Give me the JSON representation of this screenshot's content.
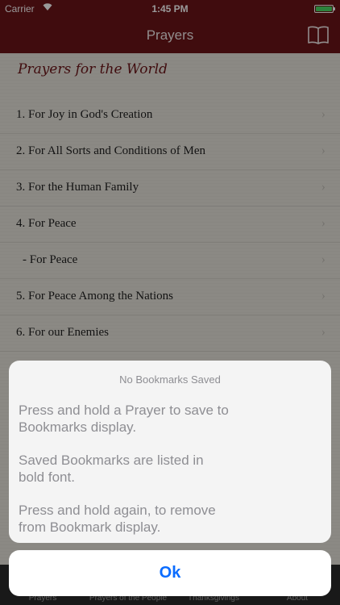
{
  "status": {
    "carrier": "Carrier",
    "time": "1:45 PM"
  },
  "navbar": {
    "title": "Prayers"
  },
  "section": {
    "title": "Prayers for the World"
  },
  "list": [
    "1. For Joy in God's Creation",
    "2. For All Sorts and Conditions of Men",
    "3. For the Human Family",
    "4. For Peace",
    "- For Peace",
    "5. For Peace Among the Nations",
    "6. For our Enemies"
  ],
  "tabs": [
    "Prayers",
    "Prayers of the People",
    "Thanksgivings",
    "About"
  ],
  "alert": {
    "title": "No Bookmarks Saved",
    "message_1_line_1": "Press and hold a Prayer to save to",
    "message_1_line_2": "Bookmarks display.",
    "message_2_line_1": "Saved Bookmarks are listed in",
    "message_2_line_2": "bold font.",
    "message_3_line_1": "Press and hold again, to remove",
    "message_3_line_2": "from Bookmark display.",
    "ok_label": "Ok"
  },
  "colors": {
    "brand": "#6b1418",
    "accent": "#0a6cff",
    "battery": "#4cd964"
  }
}
